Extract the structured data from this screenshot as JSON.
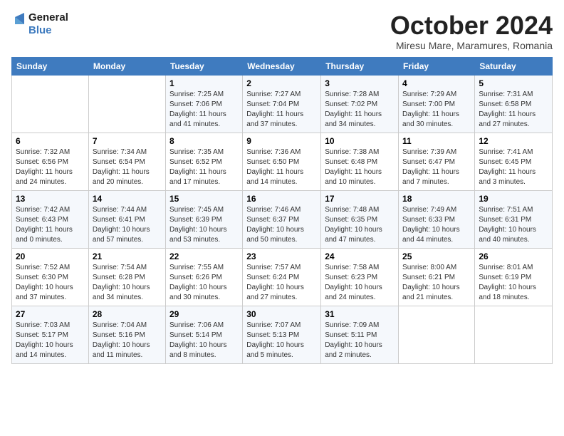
{
  "logo": {
    "line1": "General",
    "line2": "Blue"
  },
  "title": "October 2024",
  "location": "Miresu Mare, Maramures, Romania",
  "days_of_week": [
    "Sunday",
    "Monday",
    "Tuesday",
    "Wednesday",
    "Thursday",
    "Friday",
    "Saturday"
  ],
  "weeks": [
    [
      {
        "day": "",
        "sunrise": "",
        "sunset": "",
        "daylight": ""
      },
      {
        "day": "",
        "sunrise": "",
        "sunset": "",
        "daylight": ""
      },
      {
        "day": "1",
        "sunrise": "Sunrise: 7:25 AM",
        "sunset": "Sunset: 7:06 PM",
        "daylight": "Daylight: 11 hours and 41 minutes."
      },
      {
        "day": "2",
        "sunrise": "Sunrise: 7:27 AM",
        "sunset": "Sunset: 7:04 PM",
        "daylight": "Daylight: 11 hours and 37 minutes."
      },
      {
        "day": "3",
        "sunrise": "Sunrise: 7:28 AM",
        "sunset": "Sunset: 7:02 PM",
        "daylight": "Daylight: 11 hours and 34 minutes."
      },
      {
        "day": "4",
        "sunrise": "Sunrise: 7:29 AM",
        "sunset": "Sunset: 7:00 PM",
        "daylight": "Daylight: 11 hours and 30 minutes."
      },
      {
        "day": "5",
        "sunrise": "Sunrise: 7:31 AM",
        "sunset": "Sunset: 6:58 PM",
        "daylight": "Daylight: 11 hours and 27 minutes."
      }
    ],
    [
      {
        "day": "6",
        "sunrise": "Sunrise: 7:32 AM",
        "sunset": "Sunset: 6:56 PM",
        "daylight": "Daylight: 11 hours and 24 minutes."
      },
      {
        "day": "7",
        "sunrise": "Sunrise: 7:34 AM",
        "sunset": "Sunset: 6:54 PM",
        "daylight": "Daylight: 11 hours and 20 minutes."
      },
      {
        "day": "8",
        "sunrise": "Sunrise: 7:35 AM",
        "sunset": "Sunset: 6:52 PM",
        "daylight": "Daylight: 11 hours and 17 minutes."
      },
      {
        "day": "9",
        "sunrise": "Sunrise: 7:36 AM",
        "sunset": "Sunset: 6:50 PM",
        "daylight": "Daylight: 11 hours and 14 minutes."
      },
      {
        "day": "10",
        "sunrise": "Sunrise: 7:38 AM",
        "sunset": "Sunset: 6:48 PM",
        "daylight": "Daylight: 11 hours and 10 minutes."
      },
      {
        "day": "11",
        "sunrise": "Sunrise: 7:39 AM",
        "sunset": "Sunset: 6:47 PM",
        "daylight": "Daylight: 11 hours and 7 minutes."
      },
      {
        "day": "12",
        "sunrise": "Sunrise: 7:41 AM",
        "sunset": "Sunset: 6:45 PM",
        "daylight": "Daylight: 11 hours and 3 minutes."
      }
    ],
    [
      {
        "day": "13",
        "sunrise": "Sunrise: 7:42 AM",
        "sunset": "Sunset: 6:43 PM",
        "daylight": "Daylight: 11 hours and 0 minutes."
      },
      {
        "day": "14",
        "sunrise": "Sunrise: 7:44 AM",
        "sunset": "Sunset: 6:41 PM",
        "daylight": "Daylight: 10 hours and 57 minutes."
      },
      {
        "day": "15",
        "sunrise": "Sunrise: 7:45 AM",
        "sunset": "Sunset: 6:39 PM",
        "daylight": "Daylight: 10 hours and 53 minutes."
      },
      {
        "day": "16",
        "sunrise": "Sunrise: 7:46 AM",
        "sunset": "Sunset: 6:37 PM",
        "daylight": "Daylight: 10 hours and 50 minutes."
      },
      {
        "day": "17",
        "sunrise": "Sunrise: 7:48 AM",
        "sunset": "Sunset: 6:35 PM",
        "daylight": "Daylight: 10 hours and 47 minutes."
      },
      {
        "day": "18",
        "sunrise": "Sunrise: 7:49 AM",
        "sunset": "Sunset: 6:33 PM",
        "daylight": "Daylight: 10 hours and 44 minutes."
      },
      {
        "day": "19",
        "sunrise": "Sunrise: 7:51 AM",
        "sunset": "Sunset: 6:31 PM",
        "daylight": "Daylight: 10 hours and 40 minutes."
      }
    ],
    [
      {
        "day": "20",
        "sunrise": "Sunrise: 7:52 AM",
        "sunset": "Sunset: 6:30 PM",
        "daylight": "Daylight: 10 hours and 37 minutes."
      },
      {
        "day": "21",
        "sunrise": "Sunrise: 7:54 AM",
        "sunset": "Sunset: 6:28 PM",
        "daylight": "Daylight: 10 hours and 34 minutes."
      },
      {
        "day": "22",
        "sunrise": "Sunrise: 7:55 AM",
        "sunset": "Sunset: 6:26 PM",
        "daylight": "Daylight: 10 hours and 30 minutes."
      },
      {
        "day": "23",
        "sunrise": "Sunrise: 7:57 AM",
        "sunset": "Sunset: 6:24 PM",
        "daylight": "Daylight: 10 hours and 27 minutes."
      },
      {
        "day": "24",
        "sunrise": "Sunrise: 7:58 AM",
        "sunset": "Sunset: 6:23 PM",
        "daylight": "Daylight: 10 hours and 24 minutes."
      },
      {
        "day": "25",
        "sunrise": "Sunrise: 8:00 AM",
        "sunset": "Sunset: 6:21 PM",
        "daylight": "Daylight: 10 hours and 21 minutes."
      },
      {
        "day": "26",
        "sunrise": "Sunrise: 8:01 AM",
        "sunset": "Sunset: 6:19 PM",
        "daylight": "Daylight: 10 hours and 18 minutes."
      }
    ],
    [
      {
        "day": "27",
        "sunrise": "Sunrise: 7:03 AM",
        "sunset": "Sunset: 5:17 PM",
        "daylight": "Daylight: 10 hours and 14 minutes."
      },
      {
        "day": "28",
        "sunrise": "Sunrise: 7:04 AM",
        "sunset": "Sunset: 5:16 PM",
        "daylight": "Daylight: 10 hours and 11 minutes."
      },
      {
        "day": "29",
        "sunrise": "Sunrise: 7:06 AM",
        "sunset": "Sunset: 5:14 PM",
        "daylight": "Daylight: 10 hours and 8 minutes."
      },
      {
        "day": "30",
        "sunrise": "Sunrise: 7:07 AM",
        "sunset": "Sunset: 5:13 PM",
        "daylight": "Daylight: 10 hours and 5 minutes."
      },
      {
        "day": "31",
        "sunrise": "Sunrise: 7:09 AM",
        "sunset": "Sunset: 5:11 PM",
        "daylight": "Daylight: 10 hours and 2 minutes."
      },
      {
        "day": "",
        "sunrise": "",
        "sunset": "",
        "daylight": ""
      },
      {
        "day": "",
        "sunrise": "",
        "sunset": "",
        "daylight": ""
      }
    ]
  ]
}
